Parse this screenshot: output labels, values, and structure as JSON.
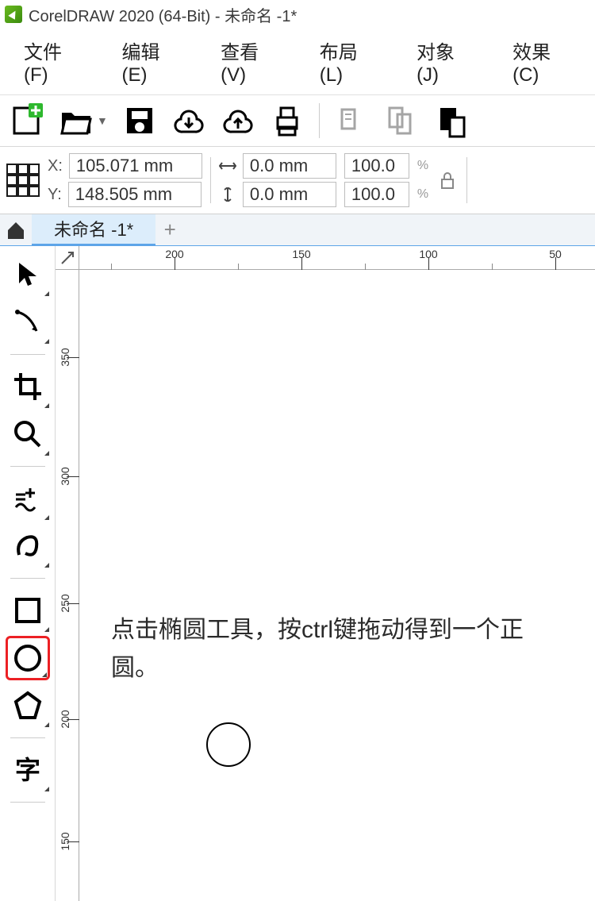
{
  "title": "CorelDRAW 2020 (64-Bit) - 未命名 -1*",
  "menu": {
    "file": "文件(F)",
    "edit": "编辑(E)",
    "view": "查看(V)",
    "layout": "布局(L)",
    "object": "对象(J)",
    "effects": "效果(C)"
  },
  "prop": {
    "xlabel": "X:",
    "ylabel": "Y:",
    "x": "105.071 mm",
    "y": "148.505 mm",
    "w": "0.0 mm",
    "h": "0.0 mm",
    "sx": "100.0",
    "sy": "100.0",
    "pct": "%"
  },
  "tabs": {
    "active": "未命名 -1*",
    "add": "+"
  },
  "ruler_h": [
    "200",
    "150",
    "100",
    "50"
  ],
  "ruler_v": [
    "350",
    "300",
    "250",
    "200",
    "150"
  ],
  "canvas": {
    "instruction": "点击椭圆工具，按ctrl键拖动得到一个正圆。"
  },
  "tools": {
    "pick": "pick-tool",
    "shape": "shape-tool",
    "crop": "crop-tool",
    "zoom": "zoom-tool",
    "freehand": "freehand-tool",
    "artistic": "artistic-media-tool",
    "rect": "rectangle-tool",
    "ellipse": "ellipse-tool",
    "polygon": "polygon-tool",
    "text": "text-tool"
  }
}
